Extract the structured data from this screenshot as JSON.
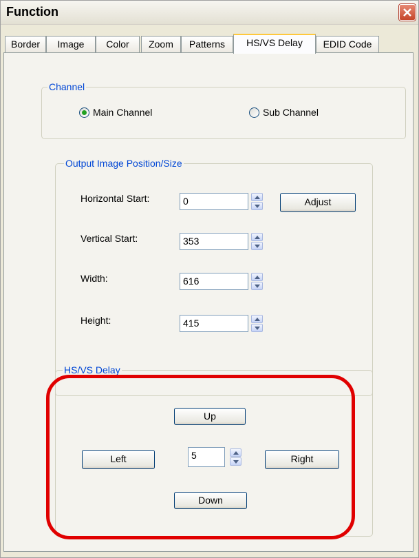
{
  "window": {
    "title": "Function"
  },
  "tabs": [
    {
      "label": "Border"
    },
    {
      "label": "Image"
    },
    {
      "label": "Color"
    },
    {
      "label": "Zoom"
    },
    {
      "label": "Patterns"
    },
    {
      "label": "HS/VS Delay",
      "active": true
    },
    {
      "label": "EDID Code"
    }
  ],
  "channel": {
    "legend": "Channel",
    "main_label": "Main Channel",
    "sub_label": "Sub Channel",
    "selected": "Main Channel"
  },
  "output": {
    "legend": "Output Image Position/Size",
    "horizontal_start": {
      "label": "Horizontal Start:",
      "value": "0"
    },
    "vertical_start": {
      "label": "Vertical Start:",
      "value": "353"
    },
    "width": {
      "label": "Width:",
      "value": "616"
    },
    "height": {
      "label": "Height:",
      "value": "415"
    },
    "adjust_label": "Adjust"
  },
  "delay": {
    "legend": "HS/VS Delay",
    "up_label": "Up",
    "left_label": "Left",
    "right_label": "Right",
    "down_label": "Down",
    "step_value": "5"
  },
  "colors": {
    "legend_blue": "#0046d5",
    "annotation_red": "#e00000",
    "active_tab_accent": "#ffc83c"
  }
}
